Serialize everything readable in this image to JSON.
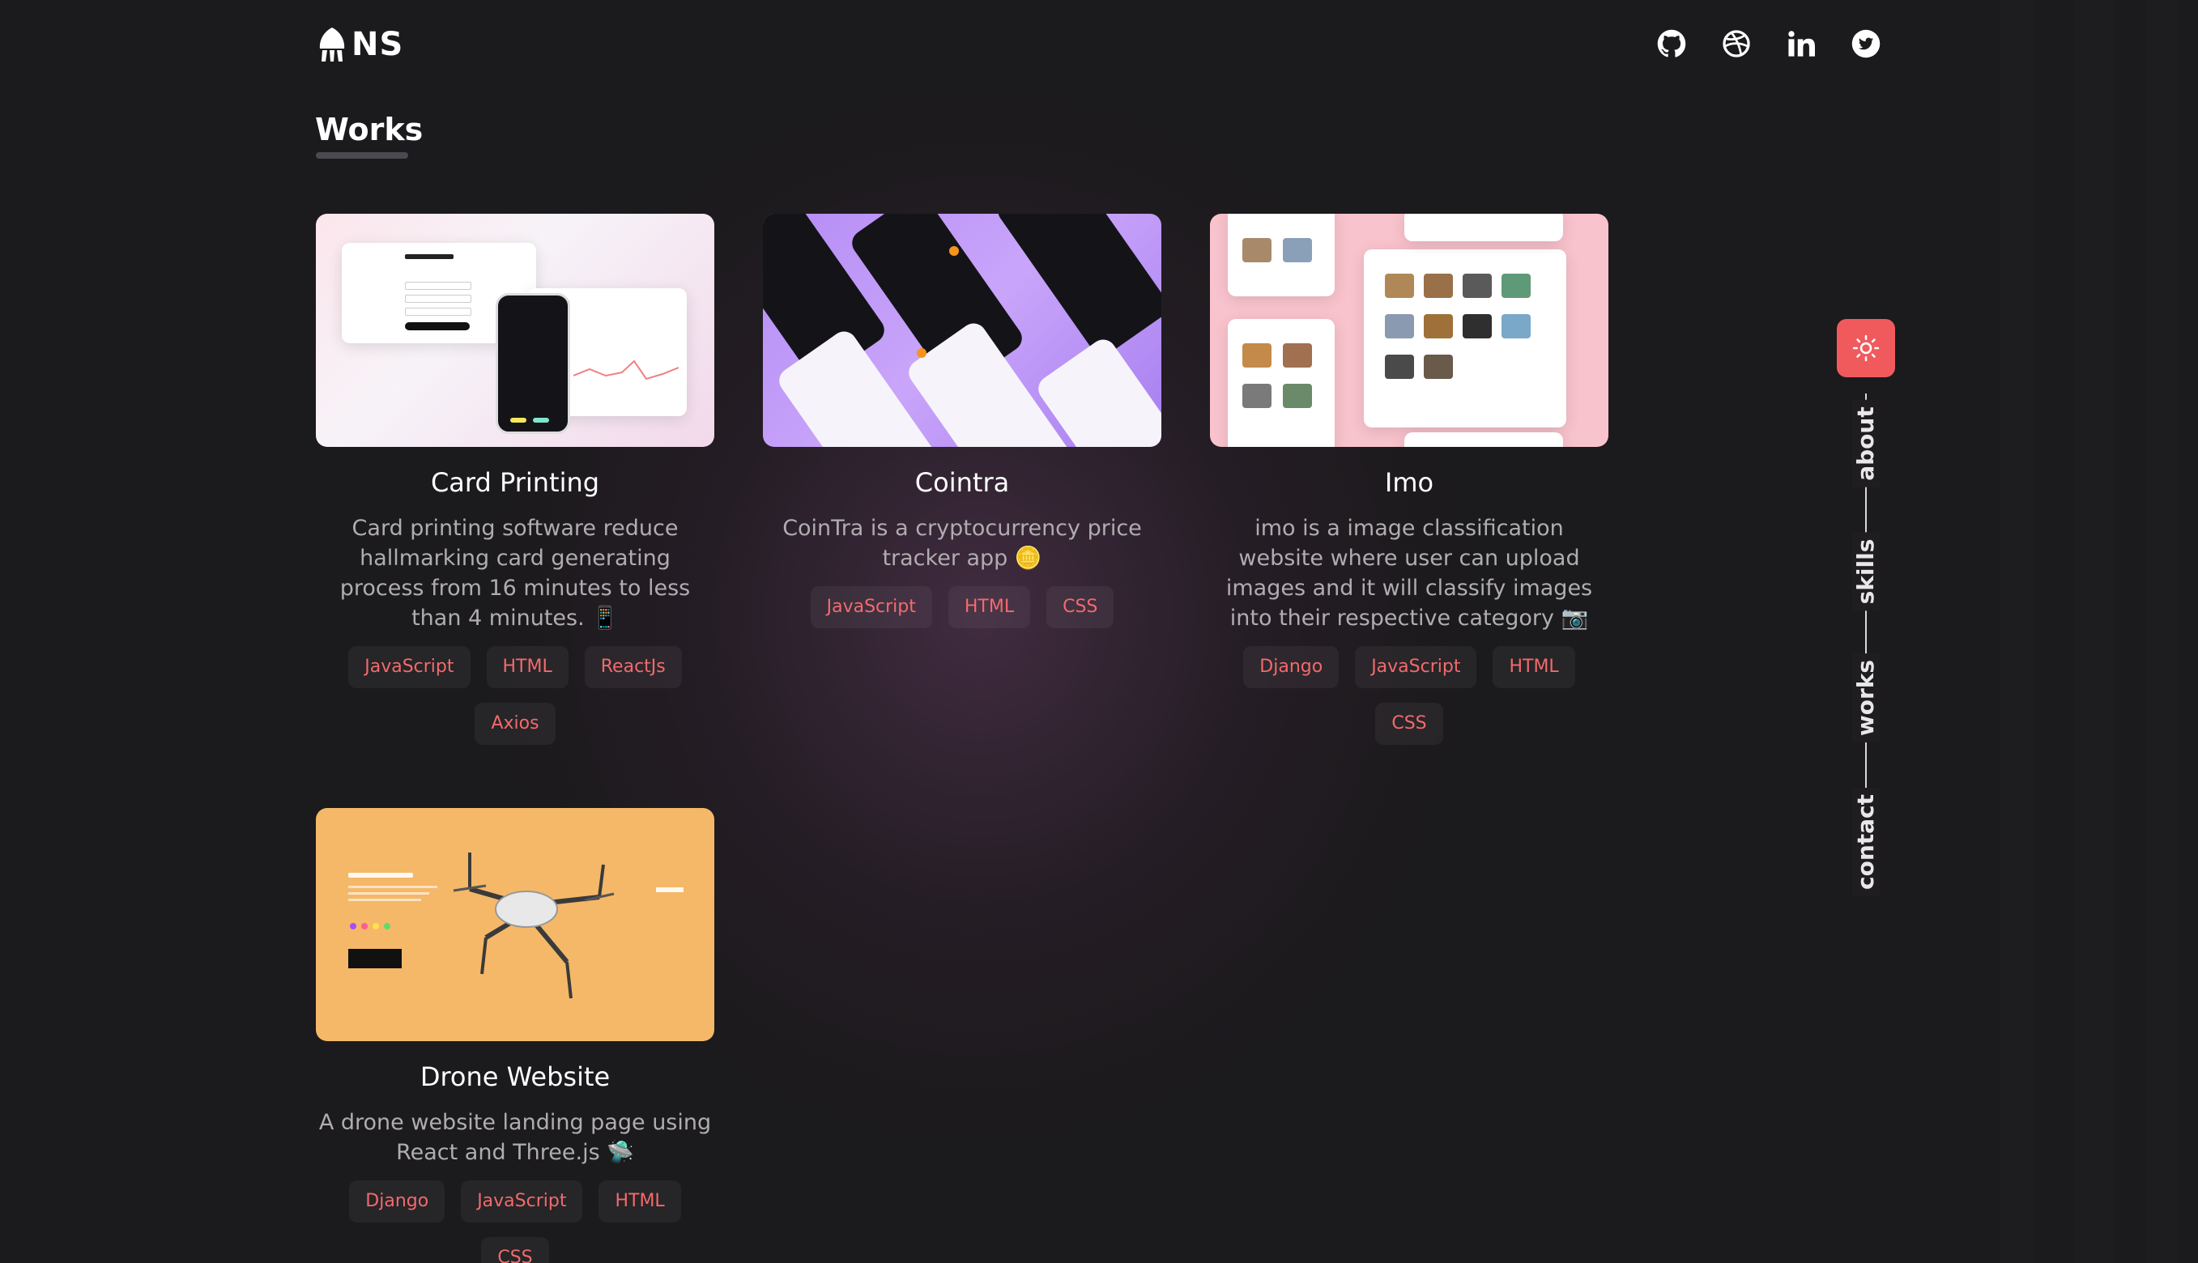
{
  "header": {
    "logo_text": "NS",
    "social_links": [
      {
        "name": "github-icon"
      },
      {
        "name": "dribbble-icon"
      },
      {
        "name": "linkedin-icon"
      },
      {
        "name": "twitter-icon"
      }
    ]
  },
  "works": {
    "title": "Works",
    "projects": [
      {
        "title": "Card Printing",
        "description": "Card printing software reduce hallmarking card generating process from 16 minutes to less than 4 minutes.",
        "emoji": "📱",
        "tags": [
          "JavaScript",
          "HTML",
          "ReactJs",
          "Axios"
        ]
      },
      {
        "title": "Cointra",
        "description": "CoinTra is a cryptocurrency price tracker app",
        "emoji": "🪙",
        "tags": [
          "JavaScript",
          "HTML",
          "CSS"
        ]
      },
      {
        "title": "Imo",
        "description": "imo is a image classification website where user can upload images and it will classify images into their respective category",
        "emoji": "📷",
        "tags": [
          "Django",
          "JavaScript",
          "HTML",
          "CSS"
        ]
      },
      {
        "title": "Drone Website",
        "description": "A drone website landing page using React and Three.js",
        "emoji": "🛸",
        "tags": [
          "Django",
          "JavaScript",
          "HTML",
          "CSS"
        ]
      }
    ]
  },
  "side_nav": {
    "items": [
      "about",
      "skills",
      "works",
      "contact"
    ],
    "theme_toggle_icon": "sun-icon"
  },
  "colors": {
    "accent": "#f05a5d",
    "tag_text": "#f26a6d",
    "background": "#1b1a1c"
  }
}
